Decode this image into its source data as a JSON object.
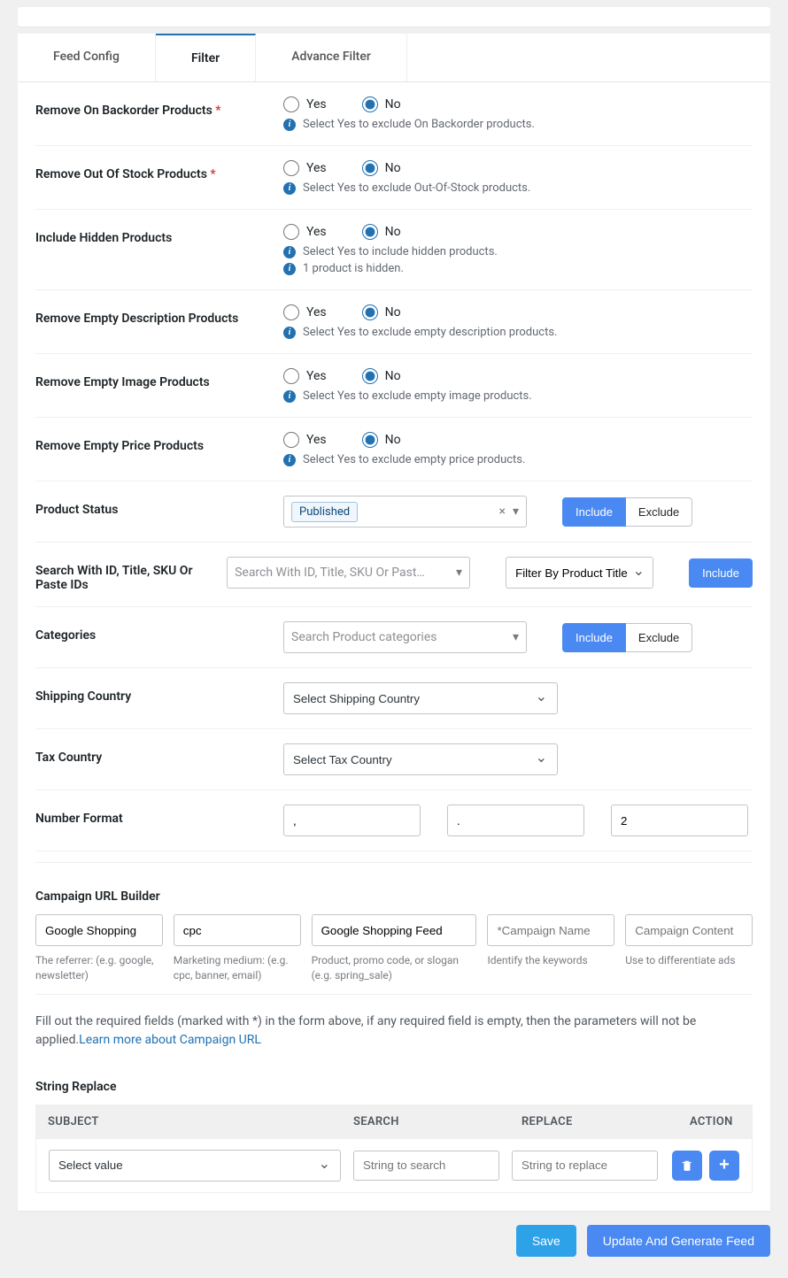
{
  "tabs": {
    "config": "Feed Config",
    "filter": "Filter",
    "advance": "Advance Filter"
  },
  "labels": {
    "backorder": "Remove On Backorder Products",
    "oos": "Remove Out Of Stock Products",
    "hidden": "Include Hidden Products",
    "empty_desc": "Remove Empty Description Products",
    "empty_img": "Remove Empty Image Products",
    "empty_price": "Remove Empty Price Products",
    "status": "Product Status",
    "search": "Search With ID, Title, SKU Or Paste IDs",
    "categories": "Categories",
    "shipping": "Shipping Country",
    "tax": "Tax Country",
    "number": "Number Format",
    "campaign": "Campaign URL Builder",
    "string_replace": "String Replace"
  },
  "radio": {
    "yes": "Yes",
    "no": "No"
  },
  "help": {
    "backorder": "Select Yes to exclude On Backorder products.",
    "oos": "Select Yes to exclude Out-Of-Stock products.",
    "hidden1": "Select Yes to include hidden products.",
    "hidden2": "1 product is hidden.",
    "empty_desc": "Select Yes to exclude empty description products.",
    "empty_img": "Select Yes to exclude empty image products.",
    "empty_price": "Select Yes to exclude empty price products."
  },
  "status_tag": "Published",
  "btn": {
    "include": "Include",
    "exclude": "Exclude",
    "save": "Save",
    "generate": "Update And Generate Feed"
  },
  "placeholder": {
    "search": "Search With ID, Title, SKU Or Past…",
    "filter_by": "Filter By Product Title",
    "categories": "Search Product categories",
    "shipping": "Select Shipping Country",
    "tax": "Select Tax Country",
    "camp_name": "*Campaign Name",
    "camp_content": "Campaign Content",
    "str_search": "String to search",
    "str_replace": "String to replace",
    "subject": "Select value"
  },
  "number_format": {
    "thousands": ",",
    "decimal": ".",
    "precision": "2"
  },
  "campaign": {
    "source": "Google Shopping",
    "medium": "cpc",
    "campaign": "Google Shopping Feed",
    "d_source": "The referrer: (e.g. google, newsletter)",
    "d_medium": "Marketing medium: (e.g. cpc, banner, email)",
    "d_campaign": "Product, promo code, or slogan (e.g. spring_sale)",
    "d_name": "Identify the keywords",
    "d_content": "Use to differentiate ads"
  },
  "note": {
    "text": "Fill out the required fields (marked with *) in the form above, if any required field is empty, then the parameters will not be applied.",
    "link": "Learn more about Campaign URL"
  },
  "table": {
    "subject": "SUBJECT",
    "search": "SEARCH",
    "replace": "REPLACE",
    "action": "ACTION"
  }
}
